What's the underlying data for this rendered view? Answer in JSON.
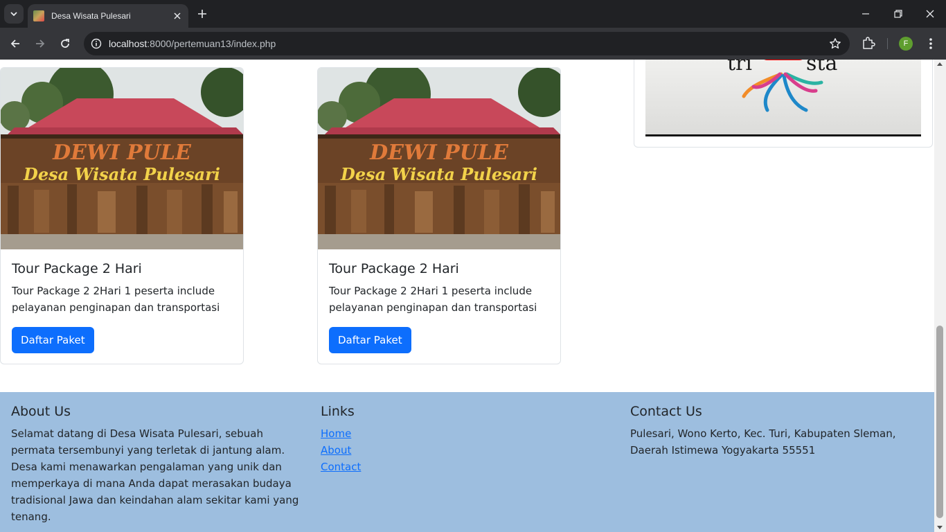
{
  "browser": {
    "tab_title": "Desa Wisata Pulesari",
    "url_host": "localhost",
    "url_rest": ":8000/pertemuan13/index.php",
    "profile_initial": "F"
  },
  "cards": [
    {
      "image_caption_line1": "DEWI PULE",
      "image_caption_line2": "Desa Wisata Pulesari",
      "title": "Tour Package 2 Hari",
      "text": "Tour Package 2 2Hari 1 peserta include pelayanan penginapan dan transportasi",
      "button": "Daftar Paket"
    },
    {
      "image_caption_line1": "DEWI PULE",
      "image_caption_line2": "Desa Wisata Pulesari",
      "title": "Tour Package 2 Hari",
      "text": "Tour Package 2 2Hari 1 peserta include pelayanan penginapan dan transportasi",
      "button": "Daftar Paket"
    }
  ],
  "video": {
    "logo_text_left": "tri",
    "logo_text_right": "sta"
  },
  "footer": {
    "about": {
      "heading": "About Us",
      "text": "Selamat datang di Desa Wisata Pulesari, sebuah permata tersembunyi yang terletak di jantung alam. Desa kami menawarkan pengalaman yang unik dan memperkaya di mana Anda dapat merasakan budaya tradisional Jawa dan keindahan alam sekitar kami yang tenang."
    },
    "links": {
      "heading": "Links",
      "items": [
        "Home",
        "About",
        "Contact"
      ]
    },
    "contact": {
      "heading": "Contact Us",
      "text": "Pulesari, Wono Kerto, Kec. Turi, Kabupaten Sleman, Daerah Istimewa Yogyakarta 55551"
    }
  },
  "colors": {
    "primary_button": "#0d6efd",
    "footer_bg": "#9dbedf",
    "chrome_dark": "#202124",
    "chrome_toolbar": "#35363a"
  }
}
